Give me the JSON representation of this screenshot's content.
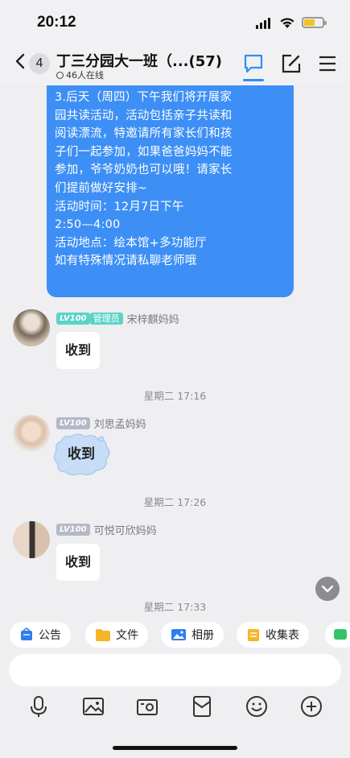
{
  "status_bar": {
    "time": "20:12"
  },
  "header": {
    "unread_count": "4",
    "title": "丁三分园大一班（...(57)",
    "online_status": "46人在线",
    "icons": [
      "chat-bubble-icon",
      "edit-icon",
      "menu-icon"
    ]
  },
  "notice": {
    "lines": [
      "3.后天（周四）下午我们将开展家",
      "园共读活动，活动包括亲子共读和",
      "阅读漂流，特邀请所有家长们和孩",
      "子们一起参加，如果爸爸妈妈不能",
      "参加，爷爷奶奶也可以哦！请家长",
      "们提前做好安排~",
      "活动时间：12月7日下午",
      "2:50—4:00",
      "活动地点：绘本馆+多功能厅",
      "如有特殊情况请私聊老师哦"
    ]
  },
  "messages": [
    {
      "level": "LV100",
      "role": "管理员",
      "sender": "宋梓麒妈妈",
      "text": "收到"
    },
    {
      "timestamp": "星期二 17:16"
    },
    {
      "level": "LV100",
      "sender": "刘思孟妈妈",
      "text": "收到"
    },
    {
      "timestamp": "星期二 17:26"
    },
    {
      "level": "LV100",
      "sender": "可悦可欣妈妈",
      "text": "收到"
    },
    {
      "timestamp": "星期二 17:33"
    }
  ],
  "quick_actions": [
    {
      "label": "公告",
      "icon": "announcement-icon",
      "color": "#2f7ef0"
    },
    {
      "label": "文件",
      "icon": "folder-icon",
      "color": "#f6b52a"
    },
    {
      "label": "相册",
      "icon": "album-icon",
      "color": "#2f7ef0"
    },
    {
      "label": "收集表",
      "icon": "form-icon",
      "color": "#f6b52a"
    }
  ],
  "input": {
    "placeholder": ""
  },
  "toolbar_icons": [
    "microphone-icon",
    "image-icon",
    "camera-icon",
    "red-packet-icon",
    "emoji-icon",
    "plus-icon"
  ],
  "colors": {
    "accent": "#3d8ff5",
    "admin_badge": "#5bd4c6",
    "level_badge": "#b5b9c7"
  }
}
